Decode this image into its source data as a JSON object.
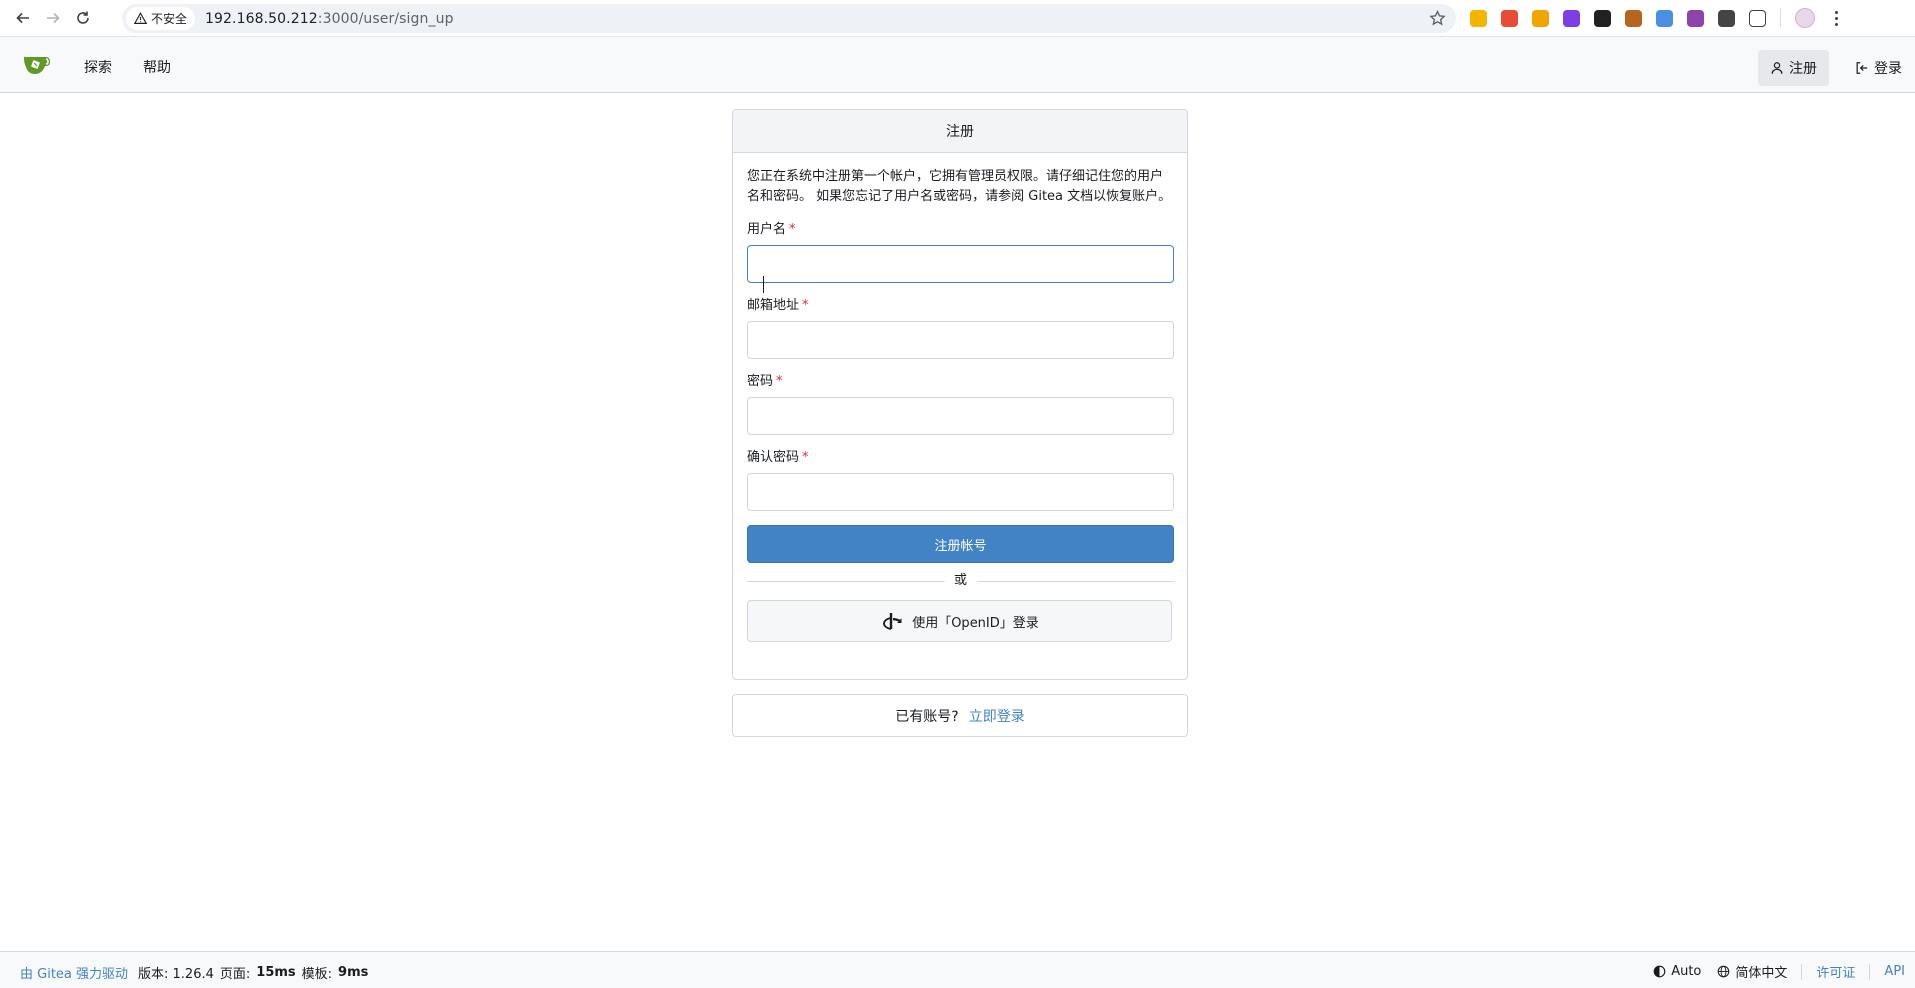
{
  "browser": {
    "security_label": "不安全",
    "url_host": "192.168.50.212",
    "url_path": ":3000/user/sign_up"
  },
  "nav": {
    "explore": "探索",
    "help": "帮助",
    "signup": "注册",
    "signin": "登录"
  },
  "signup_form": {
    "title": "注册",
    "notice": "您正在系统中注册第一个帐户，它拥有管理员权限。请仔细记住您的用户名和密码。 如果您忘记了用户名或密码，请参阅 Gitea 文档以恢复账户。",
    "required_mark": "*",
    "fields": [
      {
        "label": "用户名",
        "value": ""
      },
      {
        "label": "邮箱地址",
        "value": ""
      },
      {
        "label": "密码",
        "value": ""
      },
      {
        "label": "确认密码",
        "value": ""
      }
    ],
    "submit_label": "注册帐号",
    "divider_text": "或",
    "openid_label": "使用「OpenID」登录"
  },
  "login_prompt": {
    "text": "已有账号?",
    "link": "立即登录"
  },
  "footer": {
    "powered_by": "由 Gitea 强力驱动",
    "version": "版本: 1.26.4",
    "page_label": "页面:",
    "page_time": "15ms",
    "template_label": "模板:",
    "template_time": "9ms",
    "theme": "Auto",
    "language": "简体中文",
    "license": "许可证",
    "api": "API"
  },
  "colors": {
    "primary": "#4183c4",
    "required": "#db2828",
    "border": "#d0d7de"
  }
}
